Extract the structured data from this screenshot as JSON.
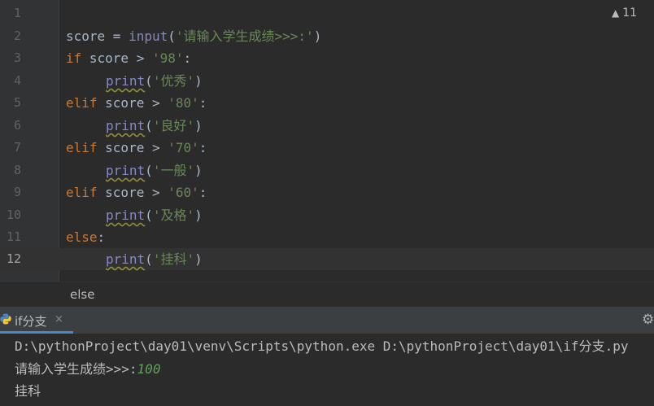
{
  "editor": {
    "warning_count": "11",
    "active_line": "12",
    "lines": [
      {
        "num": "1"
      },
      {
        "num": "2",
        "var": "score",
        "op": " = ",
        "fn": "input",
        "p1": "(",
        "str": "'请输入学生成绩>>>:'",
        "p2": ")"
      },
      {
        "num": "3",
        "kw": "if",
        "rest": " score > ",
        "str": "'98'",
        "tail": ":"
      },
      {
        "num": "4",
        "fn": "print",
        "p1": "(",
        "str": "'优秀'",
        "p2": ")"
      },
      {
        "num": "5",
        "kw": "elif",
        "rest": " score > ",
        "str": "'80'",
        "tail": ":"
      },
      {
        "num": "6",
        "fn": "print",
        "p1": "(",
        "str": "'良好'",
        "p2": ")"
      },
      {
        "num": "7",
        "kw": "elif",
        "rest": " score > ",
        "str": "'70'",
        "tail": ":"
      },
      {
        "num": "8",
        "fn": "print",
        "p1": "(",
        "str": "'一般'",
        "p2": ")"
      },
      {
        "num": "9",
        "kw": "elif",
        "rest": " score > ",
        "str": "'60'",
        "tail": ":"
      },
      {
        "num": "10",
        "fn": "print",
        "p1": "(",
        "str": "'及格'",
        "p2": ")"
      },
      {
        "num": "11",
        "kw": "else",
        "tail": ":"
      },
      {
        "num": "12",
        "fn": "print",
        "p1": "(",
        "str": "'挂科'",
        "p2": ")"
      }
    ]
  },
  "breadcrumb": {
    "text": "else"
  },
  "run_panel": {
    "tab_label": "if分支",
    "close_glyph": "×",
    "settings_glyph": "⚙",
    "console": {
      "command": "D:\\pythonProject\\day01\\venv\\Scripts\\python.exe D:\\pythonProject\\day01\\if分支.py",
      "prompt": "请输入学生成绩>>>:",
      "input_value": "100",
      "output": "挂科"
    }
  },
  "colors": {
    "keyword": "#cc7832",
    "string": "#6a8759",
    "builtin": "#8888c6",
    "text": "#a9b7c6",
    "tab_accent": "#4a88c7"
  }
}
